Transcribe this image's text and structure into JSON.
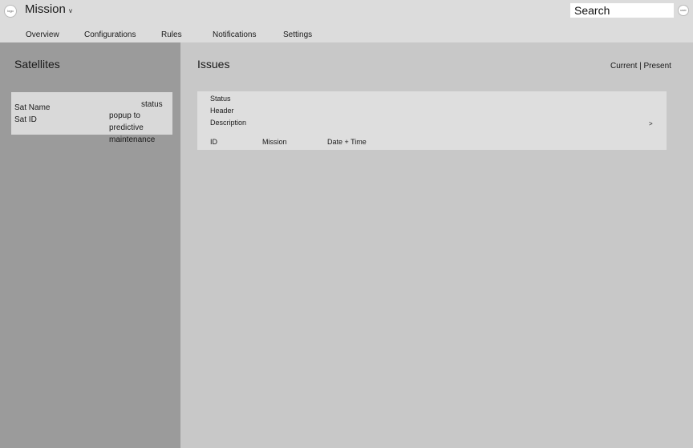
{
  "header": {
    "logo_label": "logo",
    "mission_title": "Mission",
    "mission_caret": "v",
    "search_placeholder": "Search",
    "user_label": "user"
  },
  "nav": {
    "tabs": [
      {
        "label": "Overview"
      },
      {
        "label": "Configurations"
      },
      {
        "label": "Rules"
      },
      {
        "label": "Notifications"
      },
      {
        "label": "Settings"
      }
    ]
  },
  "sidebar": {
    "title": "Satellites",
    "satellite": {
      "name": "Sat Name",
      "id": "Sat ID",
      "status": "status",
      "popup": "popup to predictive maintenance"
    }
  },
  "main": {
    "title": "Issues",
    "view_toggle": "Current | Present",
    "issue": {
      "status": "Status",
      "header": "Header",
      "description": "Description",
      "arrow": ">",
      "col_id": "ID",
      "col_mission": "Mission",
      "col_datetime": "Date + Time"
    }
  }
}
